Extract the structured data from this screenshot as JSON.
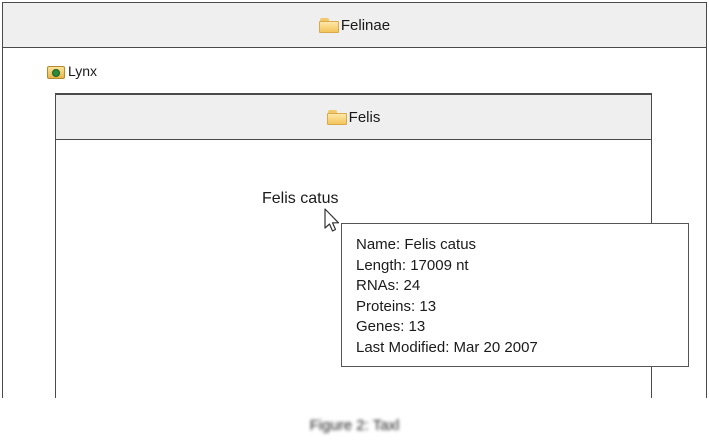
{
  "outer_panel": {
    "title": "Felinae",
    "icon": "folder-icon"
  },
  "sibling_node": {
    "label": "Lynx",
    "icon": "genome-node-icon"
  },
  "inner_panel": {
    "title": "Felis",
    "icon": "folder-icon"
  },
  "species": {
    "label": "Felis catus"
  },
  "tooltip": {
    "name": "Name: Felis catus",
    "length": "Length: 17009 nt",
    "rnas": "RNAs: 24",
    "proteins": "Proteins: 13",
    "genes": "Genes: 13",
    "last_modified": "Last Modified: Mar 20 2007"
  },
  "caption": "Figure 2: Taxl                 "
}
